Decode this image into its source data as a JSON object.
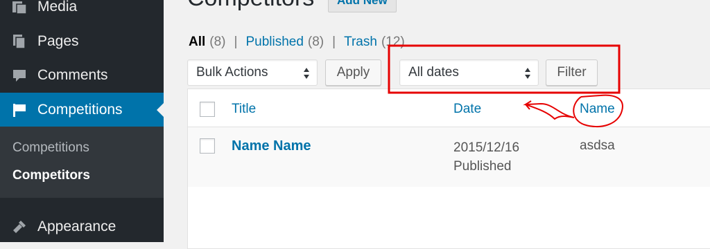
{
  "sidebar": {
    "items": [
      {
        "label": "Media",
        "icon": "media-icon"
      },
      {
        "label": "Pages",
        "icon": "pages-icon"
      },
      {
        "label": "Comments",
        "icon": "comments-icon"
      },
      {
        "label": "Competitions",
        "icon": "flag-icon",
        "active": true
      },
      {
        "label": "Appearance",
        "icon": "appearance-icon"
      }
    ],
    "submenu": [
      {
        "label": "Competitions"
      },
      {
        "label": "Competitors",
        "current": true
      }
    ]
  },
  "header": {
    "title": "Competitors",
    "add_new_label": "Add New"
  },
  "views": [
    {
      "label": "All",
      "count": "(8)",
      "current": true
    },
    {
      "label": "Published",
      "count": "(8)"
    },
    {
      "label": "Trash",
      "count": "(12)"
    }
  ],
  "separator": "|",
  "toolbar": {
    "bulk_actions_label": "Bulk Actions",
    "apply_label": "Apply",
    "date_filter_label": "All dates",
    "filter_label": "Filter"
  },
  "table": {
    "columns": [
      "Title",
      "Date",
      "Name"
    ],
    "rows": [
      {
        "title": "Name Name",
        "date": "2015/12/16",
        "status": "Published",
        "name": "asdsa"
      }
    ]
  },
  "colors": {
    "sidebar_bg": "#23282d",
    "submenu_bg": "#32373c",
    "accent": "#0073aa",
    "annotation": "#e60000"
  }
}
